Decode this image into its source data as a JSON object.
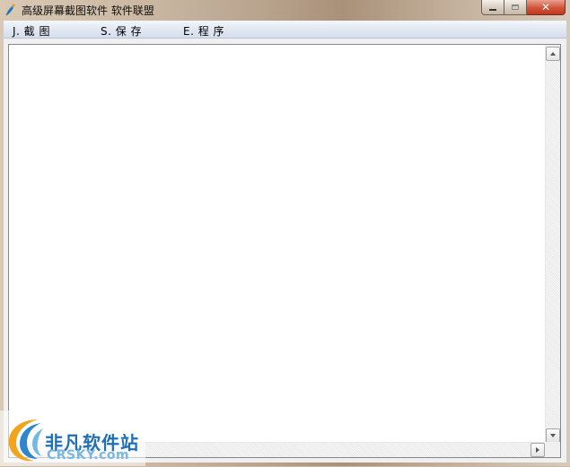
{
  "window": {
    "title": "高级屏幕截图软件   软件联盟",
    "icon": "app-feather-icon"
  },
  "caption_buttons": {
    "minimize_icon": "minimize-icon",
    "maximize_icon": "maximize-icon",
    "close_icon": "close-icon",
    "close_glyph": "✕"
  },
  "menu": {
    "items": [
      {
        "label": "J. 截  图"
      },
      {
        "label": "S. 保  存"
      },
      {
        "label": "E. 程  序"
      }
    ]
  },
  "editor": {
    "value": ""
  },
  "watermark": {
    "text_cn": "非凡软件站",
    "text_en": "CRSKY.com"
  },
  "colors": {
    "menubar": "#dfe6f1",
    "close_button": "#d0543b",
    "watermark_blue": "#1d6fb8"
  }
}
